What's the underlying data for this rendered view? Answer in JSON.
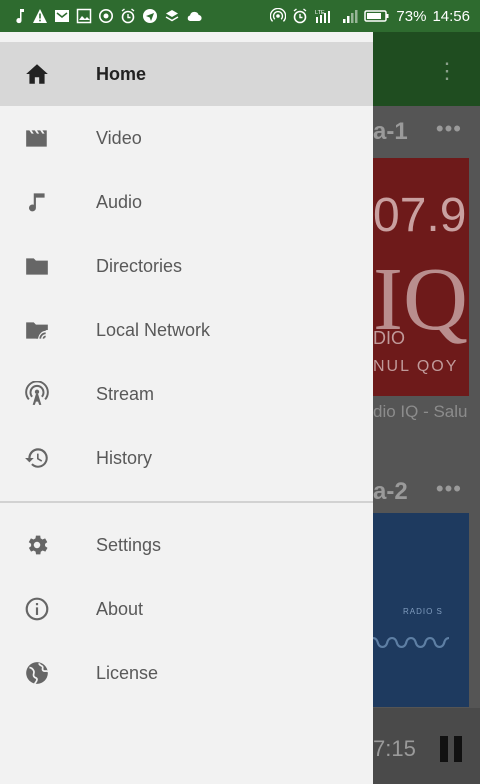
{
  "status_bar": {
    "battery": "73%",
    "time": "14:56",
    "network": "LTE"
  },
  "background_app": {
    "section_1": "a-1",
    "card_1_number": "07.9",
    "card_1_letters": "IQ",
    "card_1_sub1": "DIO",
    "card_1_sub2": "NUL QOY",
    "card_1_caption": "dio IQ - Salu",
    "section_2": "a-2",
    "card_2_label": "RADIO S",
    "player_time": "7:15"
  },
  "drawer": {
    "items": [
      {
        "label": "Home",
        "icon": "home-icon",
        "active": true
      },
      {
        "label": "Video",
        "icon": "video-icon"
      },
      {
        "label": "Audio",
        "icon": "music-note-icon"
      },
      {
        "label": "Directories",
        "icon": "folder-icon"
      },
      {
        "label": "Local Network",
        "icon": "network-folder-icon"
      },
      {
        "label": "Stream",
        "icon": "stream-icon"
      },
      {
        "label": "History",
        "icon": "history-icon"
      }
    ],
    "secondary_items": [
      {
        "label": "Settings",
        "icon": "gear-icon"
      },
      {
        "label": "About",
        "icon": "info-icon"
      },
      {
        "label": "License",
        "icon": "globe-icon"
      }
    ]
  },
  "colors": {
    "status_bar": "#2e6b2f",
    "drawer_bg": "#f2f2f2",
    "active_item_bg": "#d7d7d7",
    "icon_color": "#666666"
  }
}
